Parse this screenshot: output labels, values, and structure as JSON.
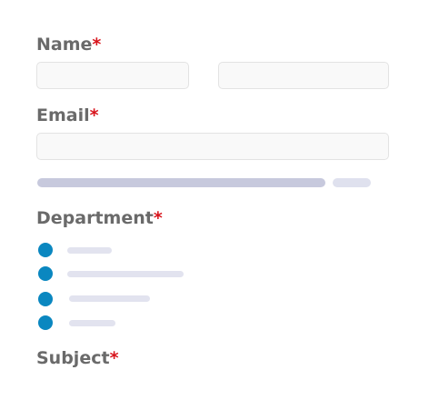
{
  "form": {
    "required_marker": "*",
    "fields": {
      "name": {
        "label": "Name",
        "first_value": "",
        "last_value": ""
      },
      "email": {
        "label": "Email",
        "value": ""
      },
      "department": {
        "label": "Department",
        "options": [
          "",
          "",
          "",
          ""
        ]
      },
      "subject": {
        "label": "Subject"
      }
    }
  },
  "colors": {
    "label": "#6a6a6a",
    "required": "#d8141c",
    "radio": "#0a87c0",
    "input_bg": "#f9f9f9",
    "input_border": "#e3e3e3",
    "placeholder_bar": "#c7c9dd"
  }
}
